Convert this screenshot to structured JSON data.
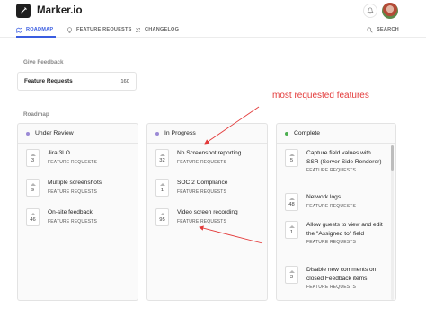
{
  "header": {
    "brand": "Marker.io"
  },
  "nav": {
    "items": [
      {
        "label": "ROADMAP",
        "active": true,
        "icon": "roadmap-icon"
      },
      {
        "label": "FEATURE REQUESTS",
        "active": false,
        "icon": "lightbulb-icon"
      },
      {
        "label": "CHANGELOG",
        "active": false,
        "icon": "changelog-icon"
      }
    ],
    "search_label": "SEARCH"
  },
  "give_feedback": {
    "section_label": "Give Feedback",
    "card_title": "Feature Requests",
    "card_count": "160"
  },
  "roadmap": {
    "section_label": "Roadmap",
    "columns": [
      {
        "title": "Under Review",
        "color": "#9b8ad6",
        "items": [
          {
            "votes": "3",
            "title": "Jira 3LO",
            "tag": "FEATURE REQUESTS"
          },
          {
            "votes": "9",
            "title": "Multiple screenshots",
            "tag": "FEATURE REQUESTS"
          },
          {
            "votes": "46",
            "title": "On-site feedback",
            "tag": "FEATURE REQUESTS"
          }
        ]
      },
      {
        "title": "In Progress",
        "color": "#9b8ad6",
        "items": [
          {
            "votes": "32",
            "title": "No Screenshot reporting",
            "tag": "FEATURE REQUESTS"
          },
          {
            "votes": "1",
            "title": "SOC 2 Compliance",
            "tag": "FEATURE REQUESTS"
          },
          {
            "votes": "95",
            "title": "Video screen recording",
            "tag": "FEATURE REQUESTS"
          }
        ]
      },
      {
        "title": "Complete",
        "color": "#4caf50",
        "items": [
          {
            "votes": "5",
            "title": "Capture field values with SSR (Server Side Renderer)",
            "tag": "FEATURE REQUESTS"
          },
          {
            "votes": "48",
            "title": "Network logs",
            "tag": "FEATURE REQUESTS"
          },
          {
            "votes": "1",
            "title": "Allow guests to view and edit the \"Assigned to\" field",
            "tag": "FEATURE REQUESTS"
          },
          {
            "votes": "3",
            "title": "Disable new comments on closed Feedback items",
            "tag": "FEATURE REQUESTS"
          }
        ]
      }
    ]
  },
  "annotation": {
    "text": "most requested features",
    "color": "#e33b3b"
  },
  "colors": {
    "accent": "#3a5de0"
  }
}
